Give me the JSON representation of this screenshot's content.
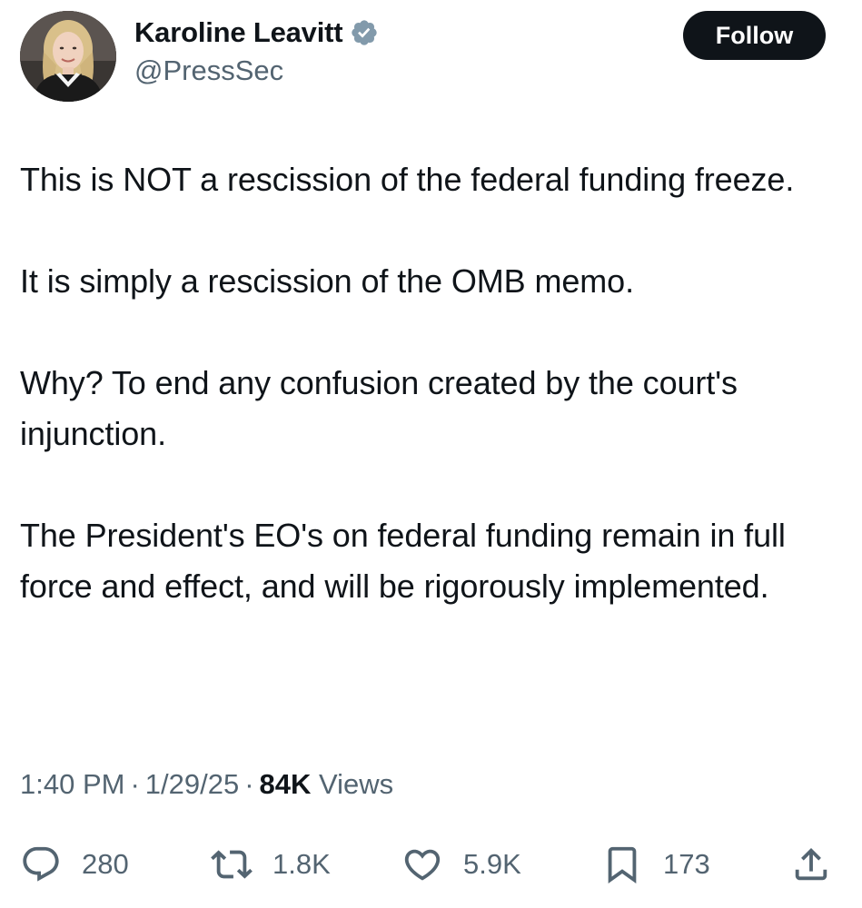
{
  "author": {
    "display_name": "Karoline Leavitt",
    "handle": "@PressSec",
    "verified_color": "#829aab",
    "avatar_icon": "profile-photo"
  },
  "follow_button": {
    "label": "Follow"
  },
  "tweet": {
    "paragraphs": [
      "This is NOT a rescission of the federal funding freeze.",
      "It is simply a rescission of the OMB memo.",
      "Why? To end any confusion created by the court's injunction.",
      "The President's EO's on federal funding remain in full force and effect, and will be rigorously implemented."
    ]
  },
  "meta": {
    "time": "1:40 PM",
    "date": "1/29/25",
    "views_count": "84K",
    "views_label": "Views",
    "separator": "·"
  },
  "actions": {
    "replies": "280",
    "retweets": "1.8K",
    "likes": "5.9K",
    "bookmarks": "173"
  },
  "colors": {
    "text_primary": "#0f1419",
    "text_secondary": "#536471",
    "button_bg": "#0f1419",
    "background": "#ffffff"
  }
}
